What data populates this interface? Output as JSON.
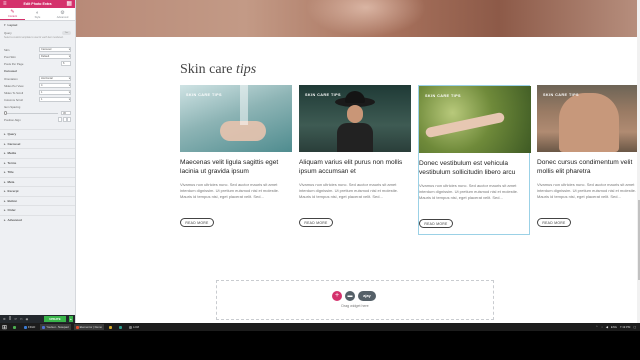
{
  "panel": {
    "title": "Edit Photo Extra",
    "tabs": [
      {
        "label": "Content",
        "icon": "pencil-icon"
      },
      {
        "label": "Style",
        "icon": "half-circle-icon"
      },
      {
        "label": "Advanced",
        "icon": "gear-icon"
      }
    ],
    "layout_title": "Layout",
    "rows_top": [
      {
        "label": "Query",
        "value": "Yes"
      },
      {
        "label": "Skin",
        "value": "Carousel"
      },
      {
        "label": "Post Skin",
        "value": "Default"
      },
      {
        "label": "Posts Per Page",
        "value": "6"
      }
    ],
    "desc": "Select a custom template to use for each item rendered.",
    "carousel_title": "Carousel",
    "rows_mid": [
      {
        "label": "Orientation",
        "value": "Horizontal"
      },
      {
        "label": "Slides Per View",
        "value": "4"
      },
      {
        "label": "Slides To Scroll",
        "value": "1"
      },
      {
        "label": "Columns Scroll",
        "value": "1"
      }
    ],
    "spacing_label": "Item Spacing",
    "spacing_value": "30",
    "align_label": "Position Align",
    "accordions": [
      "Query",
      "Carousel",
      "Media",
      "Terms",
      "Title",
      "Meta",
      "Excerpt",
      "Button",
      "Order",
      "Advanced"
    ],
    "footer": {
      "update": "UPDATE"
    }
  },
  "canvas": {
    "section_title_plain": "Skin care ",
    "section_title_italic": "tips",
    "cards": [
      {
        "badge": "SKIN CARE TIPS",
        "title": "Maecenas velit ligula sagittis eget lacinia ut gravida ipsum",
        "body": "Vivamus non ultricies nunc. Sed auctor mauris sit amet interdum dignissim. Ut pretium euismod nisl et molestie. Mauris id tempus nisi, eget placerat velit. Sed...",
        "button": "READ MORE"
      },
      {
        "badge": "SKIN CARE TIPS",
        "title": "Aliquam varius elit purus non mollis ipsum accumsan et",
        "body": "Vivamus non ultricies nunc. Sed auctor mauris sit amet interdum dignissim. Ut pretium euismod nisl et molestie. Mauris id tempus nisi, eget placerat velit. Sed...",
        "button": "READ MORE"
      },
      {
        "badge": "SKIN CARE TIPS",
        "title": "Donec vestibulum est vehicula vestibulum sollicitudin libero arcu",
        "body": "Vivamus non ultricies nunc. Sed auctor mauris sit amet interdum dignissim. Ut pretium euismod nisl et molestie. Mauris id tempus nisi, eget placerat velit. Sed...",
        "button": "READ MORE"
      },
      {
        "badge": "SKIN CARE TIPS",
        "title": "Donec cursus condimentum velit mollis elit pharetra",
        "body": "Vivamus non ultricies nunc. Sed auctor mauris sit amet interdum dignissim. Ut pretium euismod nisl et molestie. Mauris id tempus nisi, eget placerat velit. Sed...",
        "button": "READ MORE"
      }
    ],
    "dropzone": {
      "text": "Drag widget here",
      "ajax": "ajay"
    }
  },
  "taskbar": {
    "apps": [
      {
        "label": "",
        "color": "#4caf50"
      },
      {
        "label": "FDLD",
        "color": "#3a7bd5"
      },
      {
        "label": "YouGet - Notepad",
        "color": "#4f6fd1"
      },
      {
        "label": "Elementor | Demo",
        "color": "#e04b2a"
      },
      {
        "label": "",
        "color": "#d7aa2a"
      },
      {
        "label": "",
        "color": "#2a9d8f"
      },
      {
        "label": "LCM",
        "color": "#777"
      }
    ],
    "tray": {
      "lang": "ENG",
      "time": "7:19 PM"
    }
  },
  "colors": {
    "accent": "#d4316c",
    "update": "#39b54a"
  }
}
